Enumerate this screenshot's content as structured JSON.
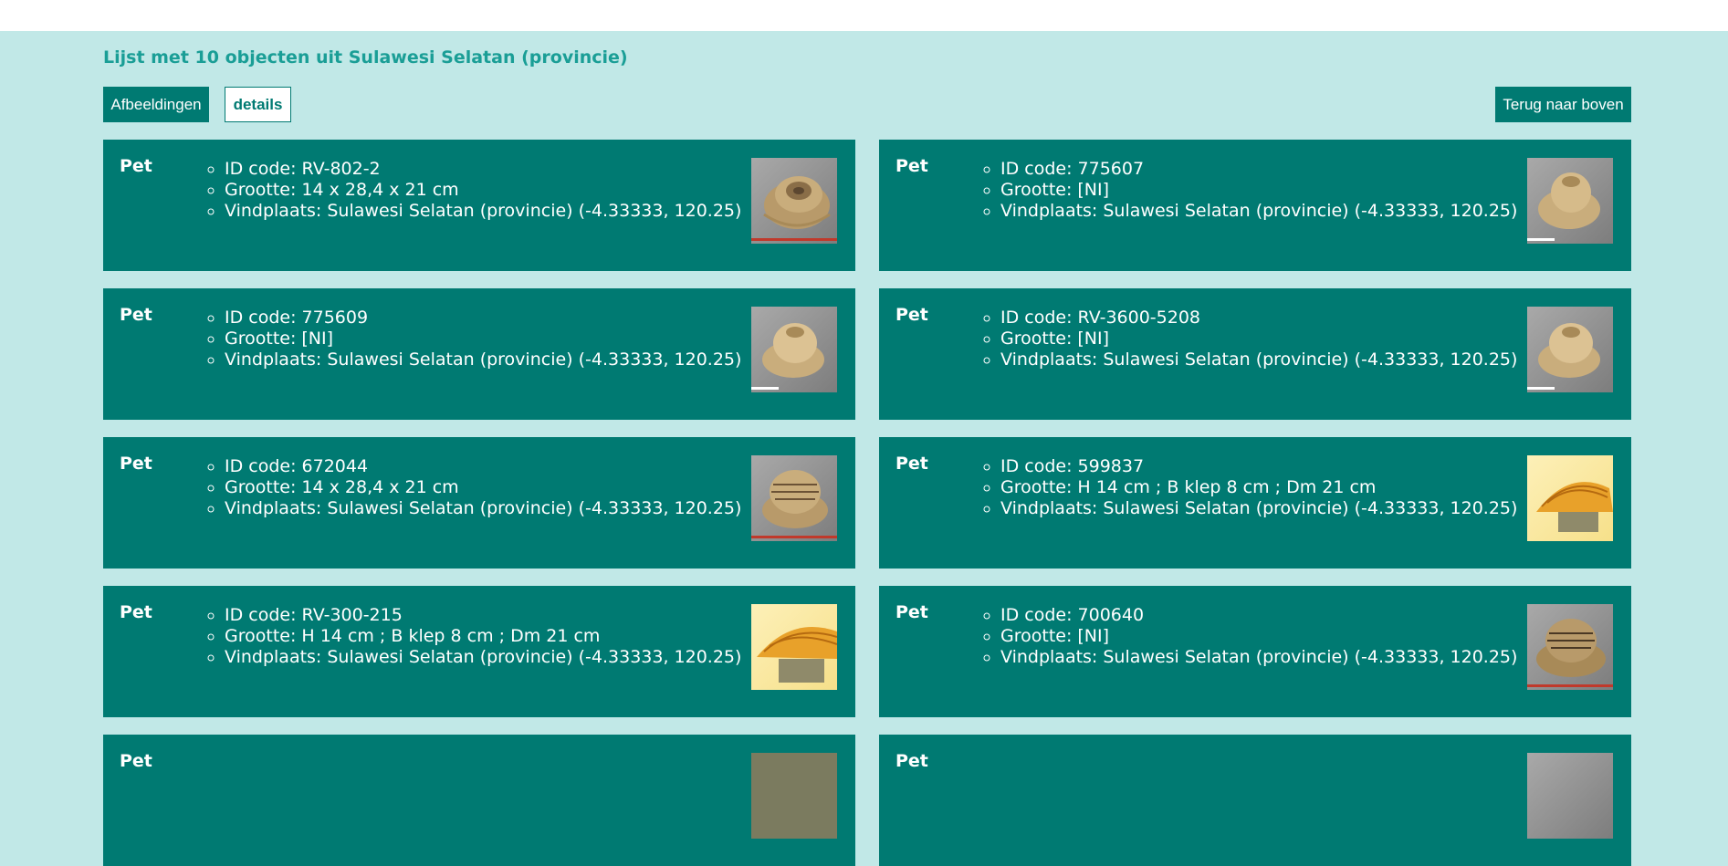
{
  "page": {
    "heading": "Lijst met 10 objecten uit Sulawesi Selatan (provincie)"
  },
  "toolbar": {
    "images_label": "Afbeeldingen",
    "details_label": "details",
    "back_to_top_label": "Terug naar boven"
  },
  "colors": {
    "background": "#c1e8e7",
    "card": "#007a72",
    "accent_text": "#1a9e96"
  },
  "items": [
    {
      "title": "Pet",
      "id": "ID code: RV-802-2",
      "size": "Grootte: 14 x 28,4 x 21 cm",
      "location": "Vindplaats: Sulawesi Selatan (provincie) (-4.33333, 120.25)",
      "thumb": "gray"
    },
    {
      "title": "Pet",
      "id": "ID code: 775607",
      "size": "Grootte: [NI]",
      "location": "Vindplaats: Sulawesi Selatan (provincie) (-4.33333, 120.25)",
      "thumb": "gray"
    },
    {
      "title": "Pet",
      "id": "ID code: 775609",
      "size": "Grootte: [NI]",
      "location": "Vindplaats: Sulawesi Selatan (provincie) (-4.33333, 120.25)",
      "thumb": "gray"
    },
    {
      "title": "Pet",
      "id": "ID code: RV-3600-5208",
      "size": "Grootte: [NI]",
      "location": "Vindplaats: Sulawesi Selatan (provincie) (-4.33333, 120.25)",
      "thumb": "gray"
    },
    {
      "title": "Pet",
      "id": "ID code: 672044",
      "size": "Grootte: 14 x 28,4 x 21 cm",
      "location": "Vindplaats: Sulawesi Selatan (provincie) (-4.33333, 120.25)",
      "thumb": "gray"
    },
    {
      "title": "Pet",
      "id": "ID code: 599837",
      "size": "Grootte: H 14 cm ; B klep 8 cm ; Dm 21 cm",
      "location": "Vindplaats: Sulawesi Selatan (provincie) (-4.33333, 120.25)",
      "thumb": "yellow"
    },
    {
      "title": "Pet",
      "id": "ID code: RV-300-215",
      "size": "Grootte: H 14 cm ; B klep 8 cm ; Dm 21 cm",
      "location": "Vindplaats: Sulawesi Selatan (provincie) (-4.33333, 120.25)",
      "thumb": "yellow"
    },
    {
      "title": "Pet",
      "id": "ID code: 700640",
      "size": "Grootte: [NI]",
      "location": "Vindplaats: Sulawesi Selatan (provincie) (-4.33333, 120.25)",
      "thumb": "gray"
    },
    {
      "title": "Pet",
      "thumb": "gray"
    },
    {
      "title": "Pet",
      "thumb": "gray"
    }
  ]
}
